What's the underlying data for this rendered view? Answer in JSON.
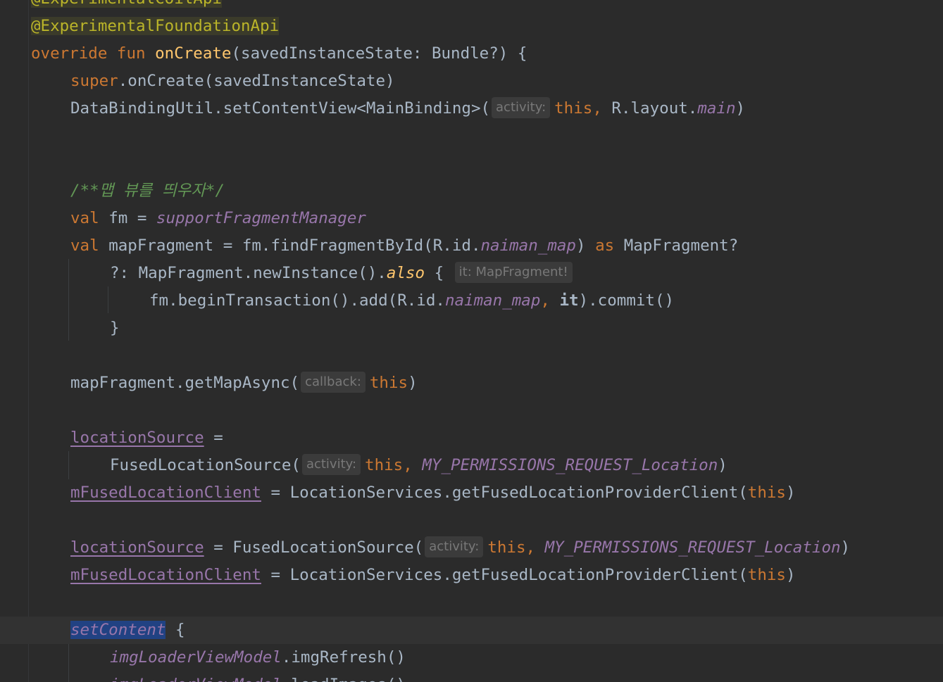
{
  "editor": {
    "lines": [
      {
        "tokens": [
          {
            "c": "ann",
            "t": "@ExperimentalCoilApi"
          }
        ]
      },
      {
        "tokens": [
          {
            "c": "ann",
            "t": "@ExperimentalFoundationApi"
          }
        ]
      },
      {
        "tokens": [
          {
            "c": "kw",
            "t": "override fun "
          },
          {
            "c": "fn",
            "t": "onCreate"
          },
          {
            "c": "",
            "t": "(savedInstanceState: Bundle?) {"
          }
        ]
      },
      {
        "tokens": [
          {
            "c": "kw",
            "t": "super"
          },
          {
            "c": "",
            "t": ".onCreate(savedInstanceState)"
          }
        ]
      },
      {
        "tokens": [
          {
            "c": "",
            "t": "DataBindingUtil.setContentView<MainBinding>("
          },
          {
            "c": "hint",
            "t": "activity:"
          },
          {
            "c": "kw",
            "t": "this, "
          },
          {
            "c": "",
            "t": "R.layout."
          },
          {
            "c": "prop",
            "t": "main"
          },
          {
            "c": "",
            "t": ")"
          }
        ]
      },
      {
        "tokens": []
      },
      {
        "tokens": []
      },
      {
        "tokens": [
          {
            "c": "cm",
            "t": "/**맵 뷰를 띄우자*/"
          }
        ]
      },
      {
        "tokens": [
          {
            "c": "kw",
            "t": "val "
          },
          {
            "c": "",
            "t": "fm = "
          },
          {
            "c": "prop",
            "t": "supportFragmentManager"
          }
        ]
      },
      {
        "tokens": [
          {
            "c": "kw",
            "t": "val "
          },
          {
            "c": "",
            "t": "mapFragment = fm.findFragmentById(R.id."
          },
          {
            "c": "prop",
            "t": "naiman_map"
          },
          {
            "c": "",
            "t": ") "
          },
          {
            "c": "kw",
            "t": "as "
          },
          {
            "c": "",
            "t": "MapFragment?"
          }
        ]
      },
      {
        "tokens": [
          {
            "c": "",
            "t": "?: MapFragment.newInstance()."
          },
          {
            "c": "ext",
            "t": "also"
          },
          {
            "c": "",
            "t": " { "
          },
          {
            "c": "hint",
            "t": "it: MapFragment!"
          }
        ]
      },
      {
        "tokens": [
          {
            "c": "",
            "t": "fm.beginTransaction().add(R.id."
          },
          {
            "c": "prop",
            "t": "naiman_map"
          },
          {
            "c": "kw",
            "t": ", "
          },
          {
            "c": "bold",
            "t": "it"
          },
          {
            "c": "",
            "t": ").commit()"
          }
        ]
      },
      {
        "tokens": [
          {
            "c": "",
            "t": "}"
          }
        ]
      },
      {
        "tokens": []
      },
      {
        "tokens": [
          {
            "c": "",
            "t": "mapFragment.getMapAsync("
          },
          {
            "c": "hint",
            "t": "callback:"
          },
          {
            "c": "kw",
            "t": "this"
          },
          {
            "c": "",
            "t": ")"
          }
        ]
      },
      {
        "tokens": []
      },
      {
        "tokens": [
          {
            "c": "ul",
            "t": "locationSource"
          },
          {
            "c": "",
            "t": " ="
          }
        ]
      },
      {
        "tokens": [
          {
            "c": "",
            "t": "FusedLocationSource("
          },
          {
            "c": "hint",
            "t": "activity:"
          },
          {
            "c": "kw",
            "t": "this, "
          },
          {
            "c": "pconst",
            "t": "MY_PERMISSIONS_REQUEST_Location"
          },
          {
            "c": "",
            "t": ")"
          }
        ]
      },
      {
        "tokens": [
          {
            "c": "ul",
            "t": "mFusedLocationClient"
          },
          {
            "c": "",
            "t": " = LocationServices.getFusedLocationProviderClient("
          },
          {
            "c": "kw",
            "t": "this"
          },
          {
            "c": "",
            "t": ")"
          }
        ]
      },
      {
        "tokens": []
      },
      {
        "tokens": [
          {
            "c": "ul",
            "t": "locationSource"
          },
          {
            "c": "",
            "t": " = FusedLocationSource("
          },
          {
            "c": "hint",
            "t": "activity:"
          },
          {
            "c": "kw",
            "t": "this, "
          },
          {
            "c": "pconst",
            "t": "MY_PERMISSIONS_REQUEST_Location"
          },
          {
            "c": "",
            "t": ")"
          }
        ]
      },
      {
        "tokens": [
          {
            "c": "ul",
            "t": "mFusedLocationClient"
          },
          {
            "c": "",
            "t": " = LocationServices.getFusedLocationProviderClient("
          },
          {
            "c": "kw",
            "t": "this"
          },
          {
            "c": "",
            "t": ")"
          }
        ]
      },
      {
        "tokens": []
      },
      {
        "tokens": [
          {
            "c": "sel",
            "t": "setContent"
          },
          {
            "c": "",
            "t": " {"
          }
        ]
      },
      {
        "tokens": [
          {
            "c": "prop",
            "t": "imgLoaderViewModel"
          },
          {
            "c": "",
            "t": ".imgRefresh()"
          }
        ]
      },
      {
        "tokens": [
          {
            "c": "prop",
            "t": "imgLoaderViewModel"
          },
          {
            "c": "",
            "t": ".loadImages()"
          }
        ]
      }
    ]
  },
  "colors": {
    "background": "#2b2b2b",
    "keyword": "#cc7832",
    "function": "#ffc66d",
    "annotation": "#bbb529",
    "comment": "#629755",
    "property": "#9876aa",
    "text": "#a9b7c6",
    "selection": "#214283"
  }
}
